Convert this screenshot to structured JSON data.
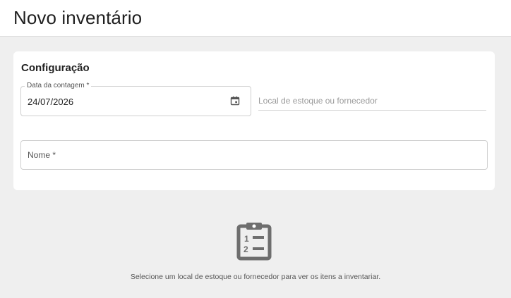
{
  "header": {
    "title": "Novo inventário"
  },
  "config": {
    "title": "Configuração",
    "date_label": "Data da contagem *",
    "date_value": "24/07/2026",
    "location_placeholder": "Local de estoque ou fornecedor",
    "name_placeholder": "Nome *"
  },
  "empty_state": {
    "message": "Selecione um local de estoque ou fornecedor para ver os itens a inventariar.",
    "icon": "clipboard-list-icon"
  },
  "colors": {
    "icon": "#6e6e6e",
    "background": "#efefef",
    "card": "#ffffff"
  }
}
